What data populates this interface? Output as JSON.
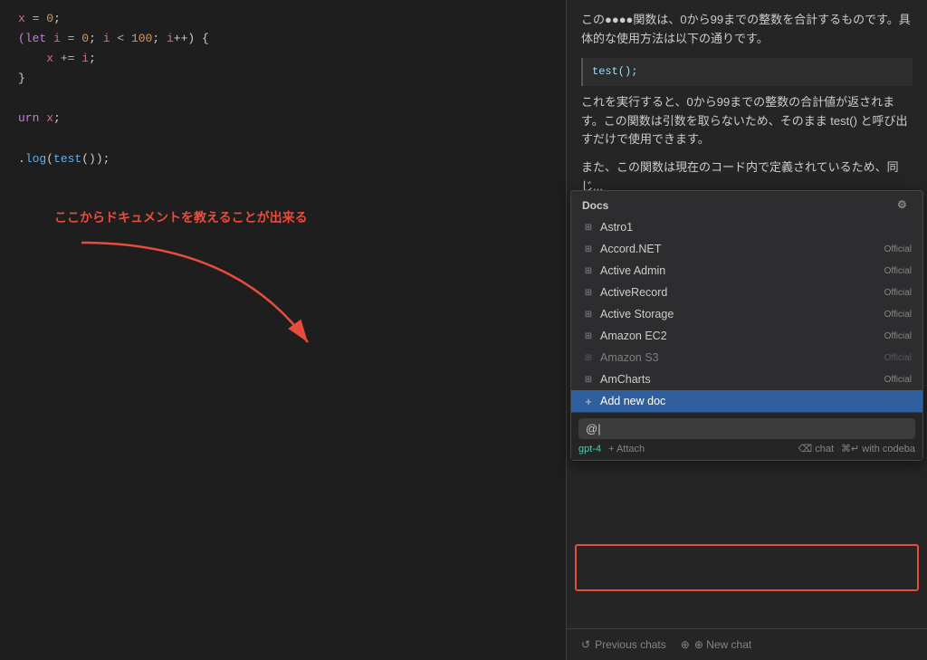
{
  "code": {
    "lines": [
      {
        "text": "x = 0;",
        "type": "plain"
      },
      {
        "text": "(let i = 0; i < 100; i++) {",
        "type": "for"
      },
      {
        "text": "    x += i;",
        "type": "plain"
      },
      {
        "text": "}",
        "type": "plain"
      },
      {
        "text": "",
        "type": "plain"
      },
      {
        "text": "urn x;",
        "type": "plain"
      },
      {
        "text": "",
        "type": "plain"
      },
      {
        "text": ".log(test());",
        "type": "log"
      }
    ]
  },
  "annotation": {
    "text": "ここからドキュメントを教えることが出来る"
  },
  "chat": {
    "description1": "この●●●●関数は、0から99までの整数を合計するものです。具体的な使用方法は以下の通りです。",
    "code_example": "test();",
    "description2": "これを実行すると、0から99までの整数の合計値が返されます。この関数は引数を取らないため、そのまま test() と呼び出すだけで使用できます。",
    "description3": "また、この関数は現在のコード内で定義されているため、同じ..."
  },
  "docs_dropdown": {
    "header": "Docs",
    "gear_icon": "⚙",
    "items": [
      {
        "id": "astro1",
        "label": "Astro1",
        "badge": "",
        "icon": "grid"
      },
      {
        "id": "accord",
        "label": "Accord.NET",
        "badge": "Official",
        "icon": "grid"
      },
      {
        "id": "active_admin",
        "label": "Active Admin",
        "badge": "Official",
        "icon": "grid"
      },
      {
        "id": "activerecord",
        "label": "ActiveRecord",
        "badge": "Official",
        "icon": "grid"
      },
      {
        "id": "active_storage",
        "label": "Active Storage",
        "badge": "Official",
        "icon": "grid"
      },
      {
        "id": "amazon_ec2",
        "label": "Amazon EC2",
        "badge": "Official",
        "icon": "grid"
      },
      {
        "id": "amazon_s3",
        "label": "Amazon S3",
        "badge": "Official",
        "icon": "grid",
        "faded": true
      },
      {
        "id": "amcharts",
        "label": "AmCharts",
        "badge": "Official",
        "icon": "grid"
      },
      {
        "id": "add_new_doc",
        "label": "Add new doc",
        "badge": "",
        "icon": "plus",
        "highlighted": true
      }
    ]
  },
  "input": {
    "at_symbol": "@|",
    "model": "gpt-4",
    "attach_label": "+ Attach",
    "chat_shortcut": "⌫ chat",
    "codeba_shortcut": "⌘↵ with codeba"
  },
  "footer": {
    "previous_chats_label": "↺ Previous chats",
    "new_chat_label": "⊕ New chat"
  }
}
